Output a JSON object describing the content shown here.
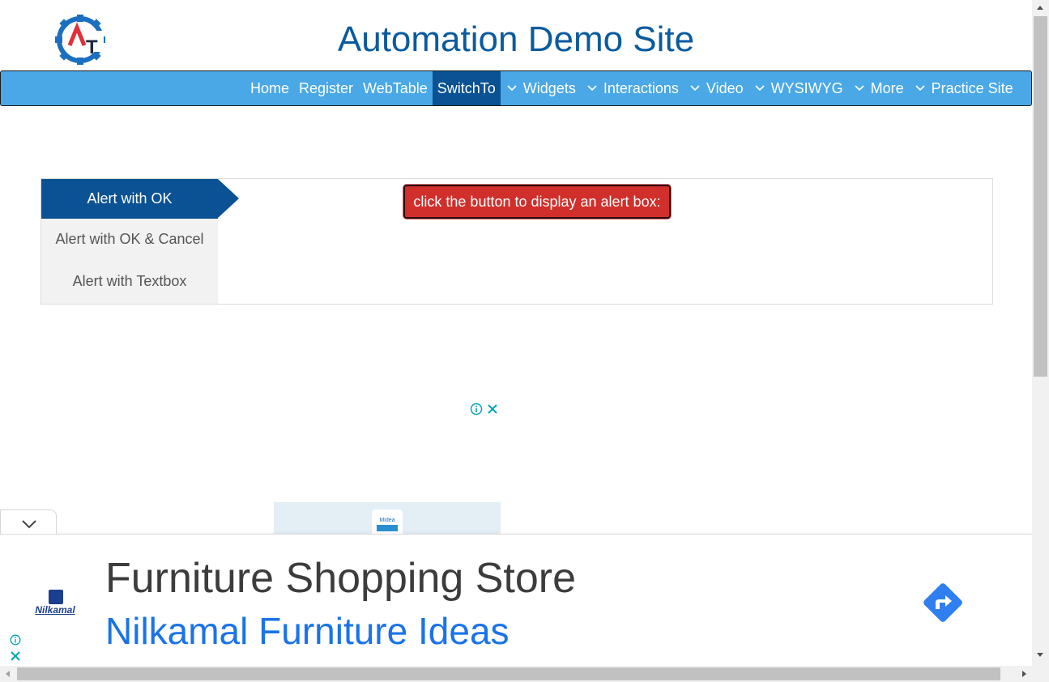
{
  "header": {
    "title": "Automation Demo Site"
  },
  "nav": {
    "items": [
      {
        "label": "Home",
        "dropdown": false,
        "active": false
      },
      {
        "label": "Register",
        "dropdown": false,
        "active": false
      },
      {
        "label": "WebTable",
        "dropdown": false,
        "active": false
      },
      {
        "label": "SwitchTo",
        "dropdown": true,
        "active": true
      },
      {
        "label": "Widgets",
        "dropdown": true,
        "active": false
      },
      {
        "label": "Interactions",
        "dropdown": true,
        "active": false
      },
      {
        "label": "Video",
        "dropdown": true,
        "active": false
      },
      {
        "label": "WYSIWYG",
        "dropdown": true,
        "active": false
      },
      {
        "label": "More",
        "dropdown": true,
        "active": false
      },
      {
        "label": "Practice Site",
        "dropdown": false,
        "active": false
      }
    ]
  },
  "tabs": [
    {
      "label": "Alert with OK",
      "active": true
    },
    {
      "label": "Alert with OK & Cancel",
      "active": false
    },
    {
      "label": "Alert with Textbox",
      "active": false
    }
  ],
  "alert_button": {
    "label": "click the button to display an alert box:"
  },
  "ad": {
    "headline": "Furniture Shopping Store",
    "subline": "Nilkamal Furniture Ideas",
    "brand": "Nilkamal",
    "image_brand": "Midea"
  },
  "colors": {
    "brand_blue": "#0a5b9e",
    "nav_bg": "#4aa8e6",
    "nav_active": "#0a5293",
    "alert_red": "#d12f2b",
    "ad_link_blue": "#1a73e8"
  }
}
